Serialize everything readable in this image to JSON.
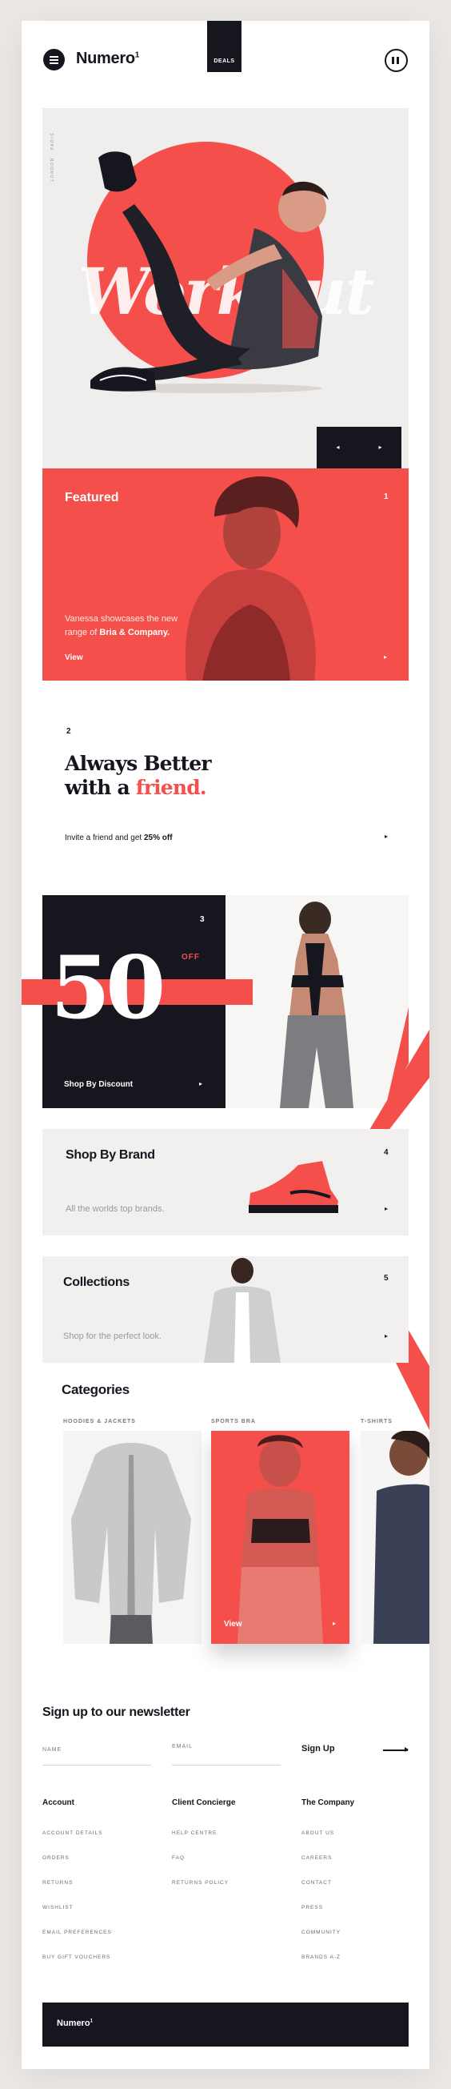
{
  "header": {
    "logo": "Numero",
    "logo_mark": "1",
    "deals_label": "DEALS",
    "menu_icon": "hamburger-icon",
    "pause_icon": "pause-icon"
  },
  "hero": {
    "ghost_text": "Workout",
    "vertical_text": "LONDON · PARIS",
    "prev_icon": "◂",
    "next_icon": "▸"
  },
  "featured": {
    "title": "Featured",
    "number": "1",
    "desc_pre": "Vanessa showcases the new range of ",
    "desc_bold": "Bria & Company.",
    "view_label": "View",
    "arrow": "▸"
  },
  "tagline": {
    "number": "2",
    "line1": "Always Better",
    "line2_pre": "with a ",
    "line2_accent": "friend.",
    "invite_pre": "Invite a friend and get ",
    "invite_bold": "25% off",
    "arrow": "▸"
  },
  "discount": {
    "number": "3",
    "big": "50",
    "off": "OFF",
    "shop_label": "Shop By Discount",
    "arrow": "▸"
  },
  "brand": {
    "title": "Shop By Brand",
    "subtitle": "All the worlds top brands.",
    "number": "4",
    "arrow": "▸"
  },
  "collections": {
    "title": "Collections",
    "subtitle": "Shop for the perfect look.",
    "number": "5",
    "arrow": "▸"
  },
  "categories": {
    "title": "Categories",
    "items": [
      {
        "label": "HOODIES & JACKETS"
      },
      {
        "label": "SPORTS BRA"
      },
      {
        "label": "T-SHIRTS"
      }
    ],
    "view_label": "View",
    "arrow": "▸"
  },
  "newsletter": {
    "title": "Sign up to our newsletter",
    "name_placeholder": "NAME",
    "email_placeholder": "EMAIL",
    "signup_label": "Sign Up"
  },
  "footer": {
    "columns": [
      {
        "heading": "Account",
        "links": [
          "ACCOUNT DETAILS",
          "ORDERS",
          "RETURNS",
          "WISHLIST",
          "EMAIL PREFERENCES",
          "BUY GIFT VOUCHERS"
        ]
      },
      {
        "heading": "Client Concierge",
        "links": [
          "HELP CENTRE",
          "FAQ",
          "RETURNS POLICY"
        ]
      },
      {
        "heading": "The Company",
        "links": [
          "ABOUT US",
          "CAREERS",
          "CONTACT",
          "PRESS",
          "COMMUNITY",
          "BRANDS A-Z"
        ]
      }
    ],
    "logo": "Numero",
    "logo_mark": "1"
  },
  "colors": {
    "accent": "#f44f4b",
    "dark": "#16161f",
    "light_panel": "#f1f0ef"
  }
}
